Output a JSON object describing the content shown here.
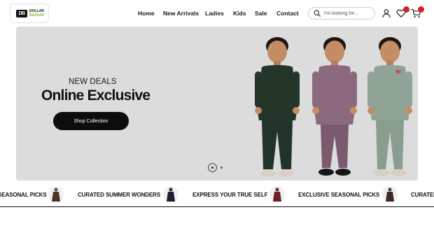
{
  "brand": {
    "mark": "DB",
    "line1": "DOLLAR",
    "line2": "BAZAAR",
    "accent": "#7bbf2a"
  },
  "nav": {
    "items": [
      "Home",
      "New Arrivals",
      "Ladies",
      "Kids",
      "Sale",
      "Contact"
    ]
  },
  "search": {
    "placeholder": "I'm looking for..."
  },
  "header_icons": {
    "account": "user-icon",
    "wishlist": "heart-icon",
    "cart": "cart-icon",
    "badge_color": "#d71f26"
  },
  "hero": {
    "subtitle": "NEW DEALS",
    "title": "Online Exclusive",
    "button": "Shop Collection",
    "slides": 2,
    "active_slide": 1
  },
  "marquee": {
    "items": [
      "SEASONAL PICKS",
      "CURATED SUMMER WONDERS",
      "EXPRESS YOUR TRUE SELF",
      "EXCLUSIVE SEASONAL PICKS",
      "CURATED"
    ]
  }
}
